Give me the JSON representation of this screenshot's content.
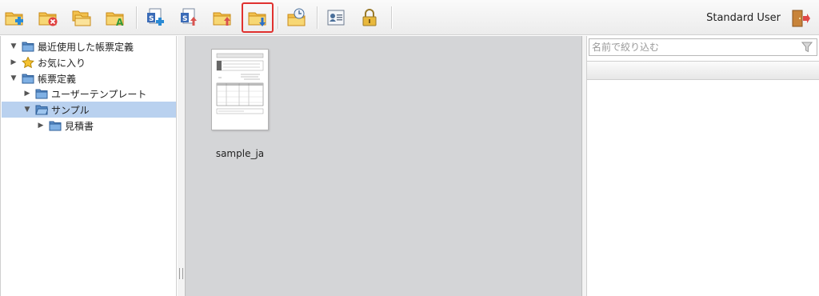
{
  "toolbar": {
    "buttons": [
      {
        "name": "new-folder-icon",
        "active": false
      },
      {
        "name": "delete-folder-icon",
        "active": false
      },
      {
        "name": "copy-folder-icon",
        "active": false
      },
      {
        "name": "rename-folder-icon",
        "active": false
      },
      {
        "name": "add-form-icon",
        "active": false
      },
      {
        "name": "upload-form-icon",
        "active": false
      },
      {
        "name": "upload-folder-icon",
        "active": false
      },
      {
        "name": "download-folder-icon",
        "active": true
      },
      {
        "name": "history-folder-icon",
        "active": false
      },
      {
        "name": "user-card-icon",
        "active": false
      },
      {
        "name": "lock-icon",
        "active": false
      }
    ],
    "user_label": "Standard User",
    "logout_icon": "logout-door-icon"
  },
  "tree": {
    "items": [
      {
        "label": "最近使用した帳票定義",
        "arrow": "▼",
        "icon": "folder-icon",
        "level": 0
      },
      {
        "label": "お気に入り",
        "arrow": "▶",
        "icon": "star-icon",
        "level": 0
      },
      {
        "label": "帳票定義",
        "arrow": "▼",
        "icon": "folder-icon",
        "level": 0
      },
      {
        "label": "ユーザーテンプレート",
        "arrow": "▶",
        "icon": "folder-icon",
        "level": 1
      },
      {
        "label": "サンプル",
        "arrow": "▼",
        "icon": "folder-open-icon",
        "level": 1,
        "selected": true
      },
      {
        "label": "見積書",
        "arrow": "▶",
        "icon": "folder-icon",
        "level": 2
      }
    ]
  },
  "content": {
    "items": [
      {
        "label": "sample_ja"
      }
    ]
  },
  "filter": {
    "placeholder": "名前で絞り込む"
  },
  "colors": {
    "accent_red": "#e0312f",
    "selection": "#b9d1ef",
    "center_bg": "#d4d5d7"
  }
}
